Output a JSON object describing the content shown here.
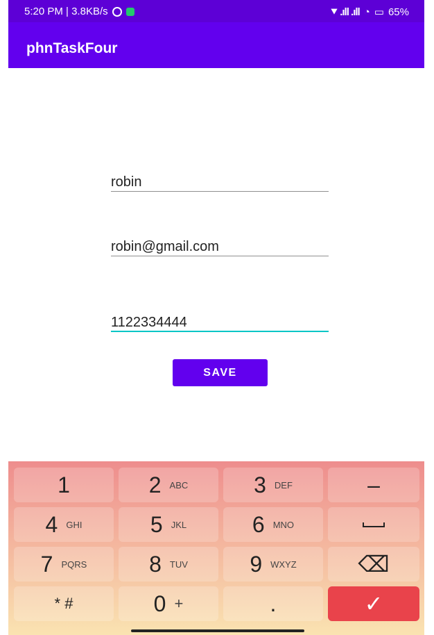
{
  "status_bar": {
    "left_text": "5:20 PM | 3.8KB/s",
    "signal_text": "⯆ .ıll .ıll",
    "battery_text": "65%",
    "icons": [
      "alarm-icon",
      "app-notification-icon",
      "location-icon",
      "signal-icon",
      "wifi-icon",
      "battery-icon"
    ]
  },
  "app_bar": {
    "title": "phnTaskFour"
  },
  "form": {
    "name_value": "robin",
    "email_value": "robin@gmail.com",
    "phone_value": "1122334444",
    "save_label": "SAVE"
  },
  "keyboard": {
    "keys": [
      {
        "main": "1",
        "sub": ""
      },
      {
        "main": "2",
        "sub": "ABC"
      },
      {
        "main": "3",
        "sub": "DEF"
      },
      {
        "main": "–",
        "sub": ""
      },
      {
        "main": "4",
        "sub": "GHI"
      },
      {
        "main": "5",
        "sub": "JKL"
      },
      {
        "main": "6",
        "sub": "MNO"
      },
      {
        "main": "⎵",
        "sub": ""
      },
      {
        "main": "7",
        "sub": "PQRS"
      },
      {
        "main": "8",
        "sub": "TUV"
      },
      {
        "main": "9",
        "sub": "WXYZ"
      },
      {
        "main": "⌫",
        "sub": ""
      },
      {
        "main": "* #",
        "sub": ""
      },
      {
        "main": "0",
        "sub": "+"
      },
      {
        "main": ".",
        "sub": ""
      },
      {
        "main": "✓",
        "sub": ""
      }
    ]
  },
  "colors": {
    "status_bar": "#5d00d6",
    "app_bar": "#6200ee",
    "field_focus": "#00c6c6",
    "done_key": "#e9434b"
  }
}
